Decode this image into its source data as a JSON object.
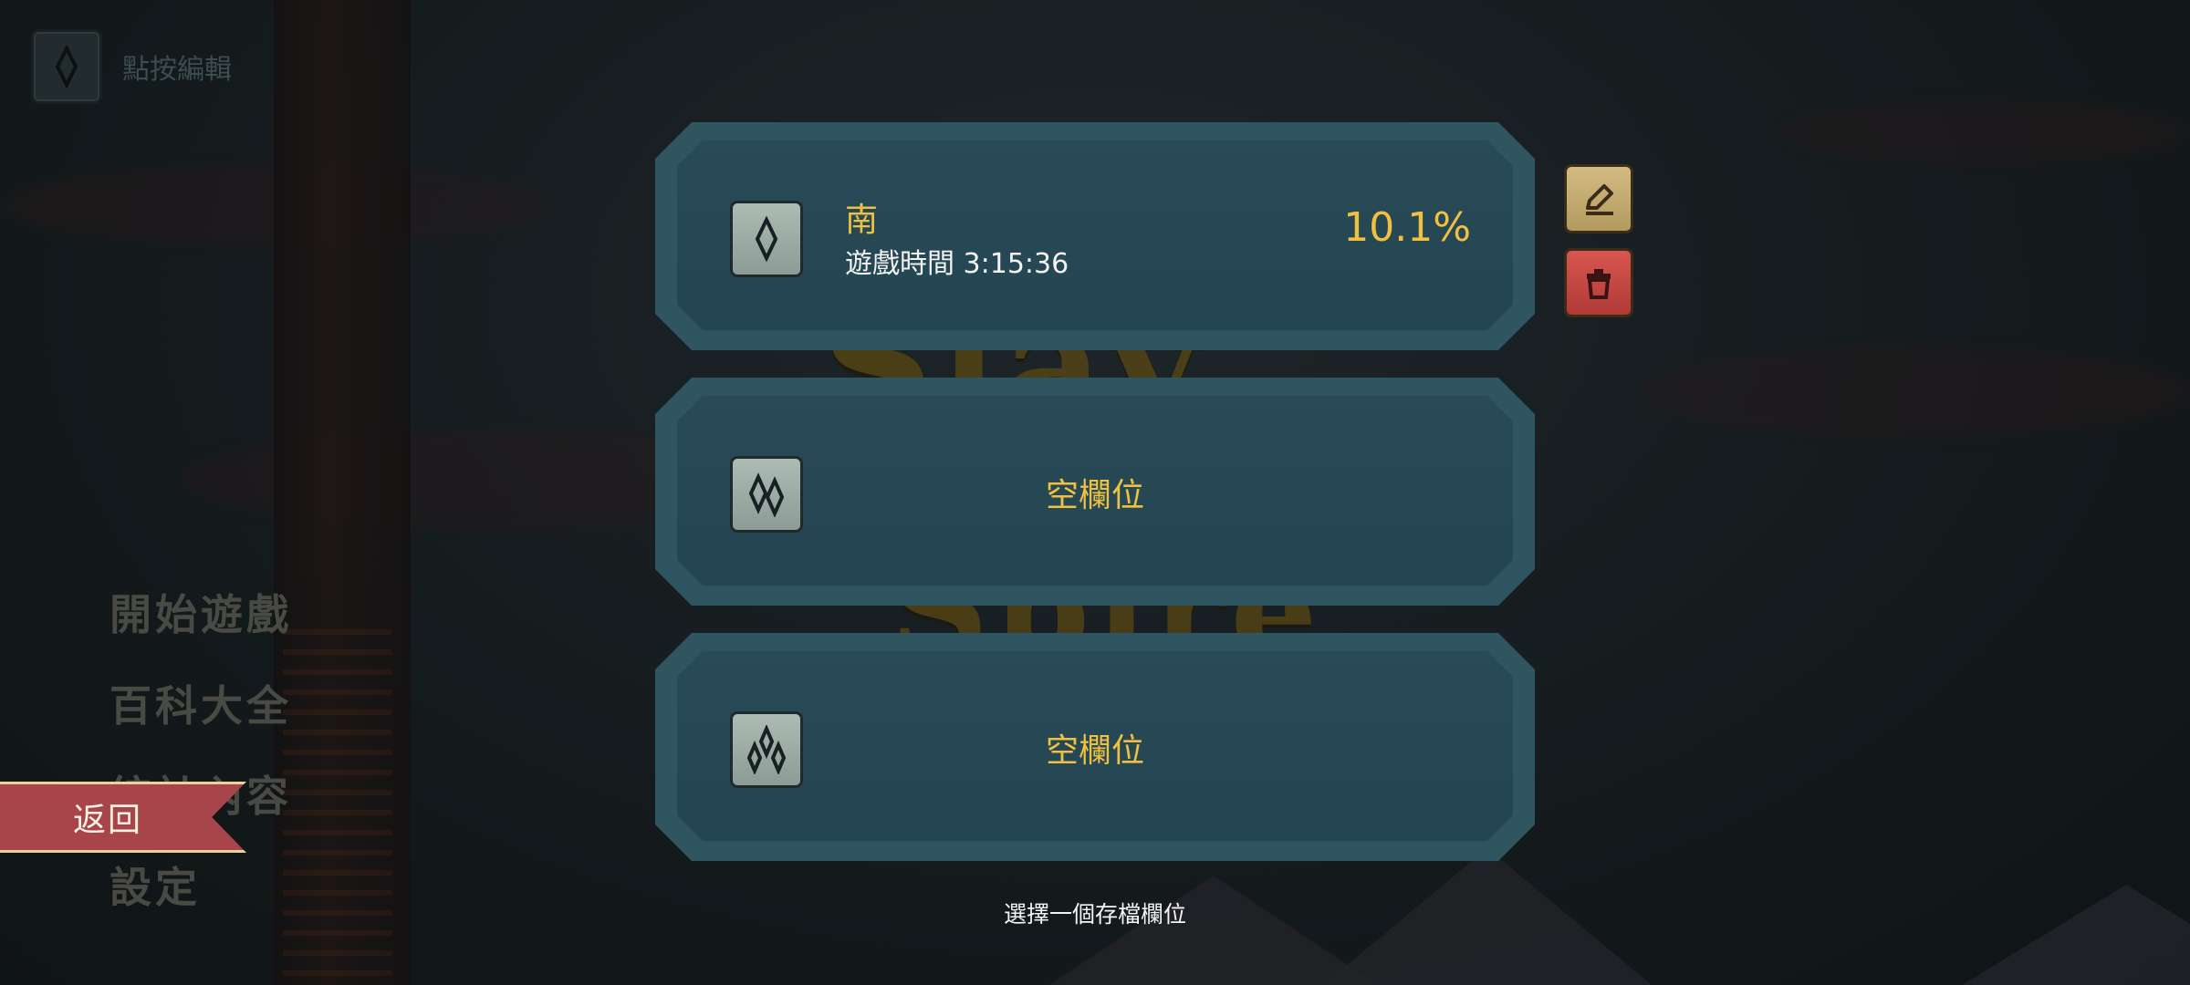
{
  "top_edit": {
    "label": "點按編輯"
  },
  "menu": {
    "items": [
      "開始遊戲",
      "百科大全",
      "統計內容",
      "設定"
    ],
    "back_label": "返回"
  },
  "background_title": {
    "line1": "Slay",
    "line2": "Spire"
  },
  "slots": [
    {
      "name": "南",
      "play_time": "遊戲時間 3:15:36",
      "completion": "10.1%",
      "icon": "slot-1-rune-icon"
    },
    {
      "empty_label": "空欄位",
      "icon": "slot-2-rune-icon"
    },
    {
      "empty_label": "空欄位",
      "icon": "slot-3-rune-icon"
    }
  ],
  "hint": "選擇一個存檔欄位",
  "colors": {
    "accent": "#f0c040",
    "slot": "#2a4f5b",
    "back": "#a8454a",
    "delete": "#c4463f",
    "rename": "#c3aa6e"
  }
}
